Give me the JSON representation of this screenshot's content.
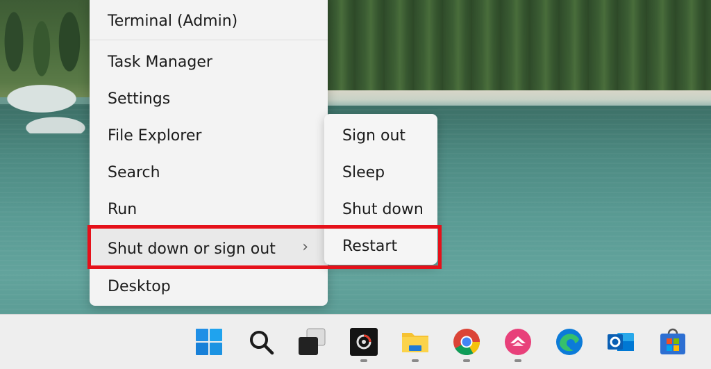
{
  "context_menu": {
    "items": [
      {
        "label": "Terminal (Admin)"
      },
      {
        "label": "Task Manager"
      },
      {
        "label": "Settings"
      },
      {
        "label": "File Explorer"
      },
      {
        "label": "Search"
      },
      {
        "label": "Run"
      },
      {
        "label": "Shut down or sign out"
      },
      {
        "label": "Desktop"
      }
    ],
    "highlighted": "Shut down or sign out"
  },
  "submenu": {
    "items": [
      {
        "label": "Sign out"
      },
      {
        "label": "Sleep"
      },
      {
        "label": "Shut down"
      },
      {
        "label": "Restart"
      }
    ]
  },
  "annotation": {
    "color": "#e5111a"
  },
  "taskbar": {
    "icons": [
      {
        "name": "windows-start-icon",
        "running": false
      },
      {
        "name": "search-icon",
        "running": false
      },
      {
        "name": "task-view-icon",
        "running": false
      },
      {
        "name": "obs-recorder-icon",
        "running": true
      },
      {
        "name": "file-explorer-icon",
        "running": true
      },
      {
        "name": "chrome-icon",
        "running": true
      },
      {
        "name": "snagit-icon",
        "running": true
      },
      {
        "name": "edge-icon",
        "running": false
      },
      {
        "name": "outlook-icon",
        "running": false
      },
      {
        "name": "microsoft-store-icon",
        "running": false
      }
    ]
  }
}
